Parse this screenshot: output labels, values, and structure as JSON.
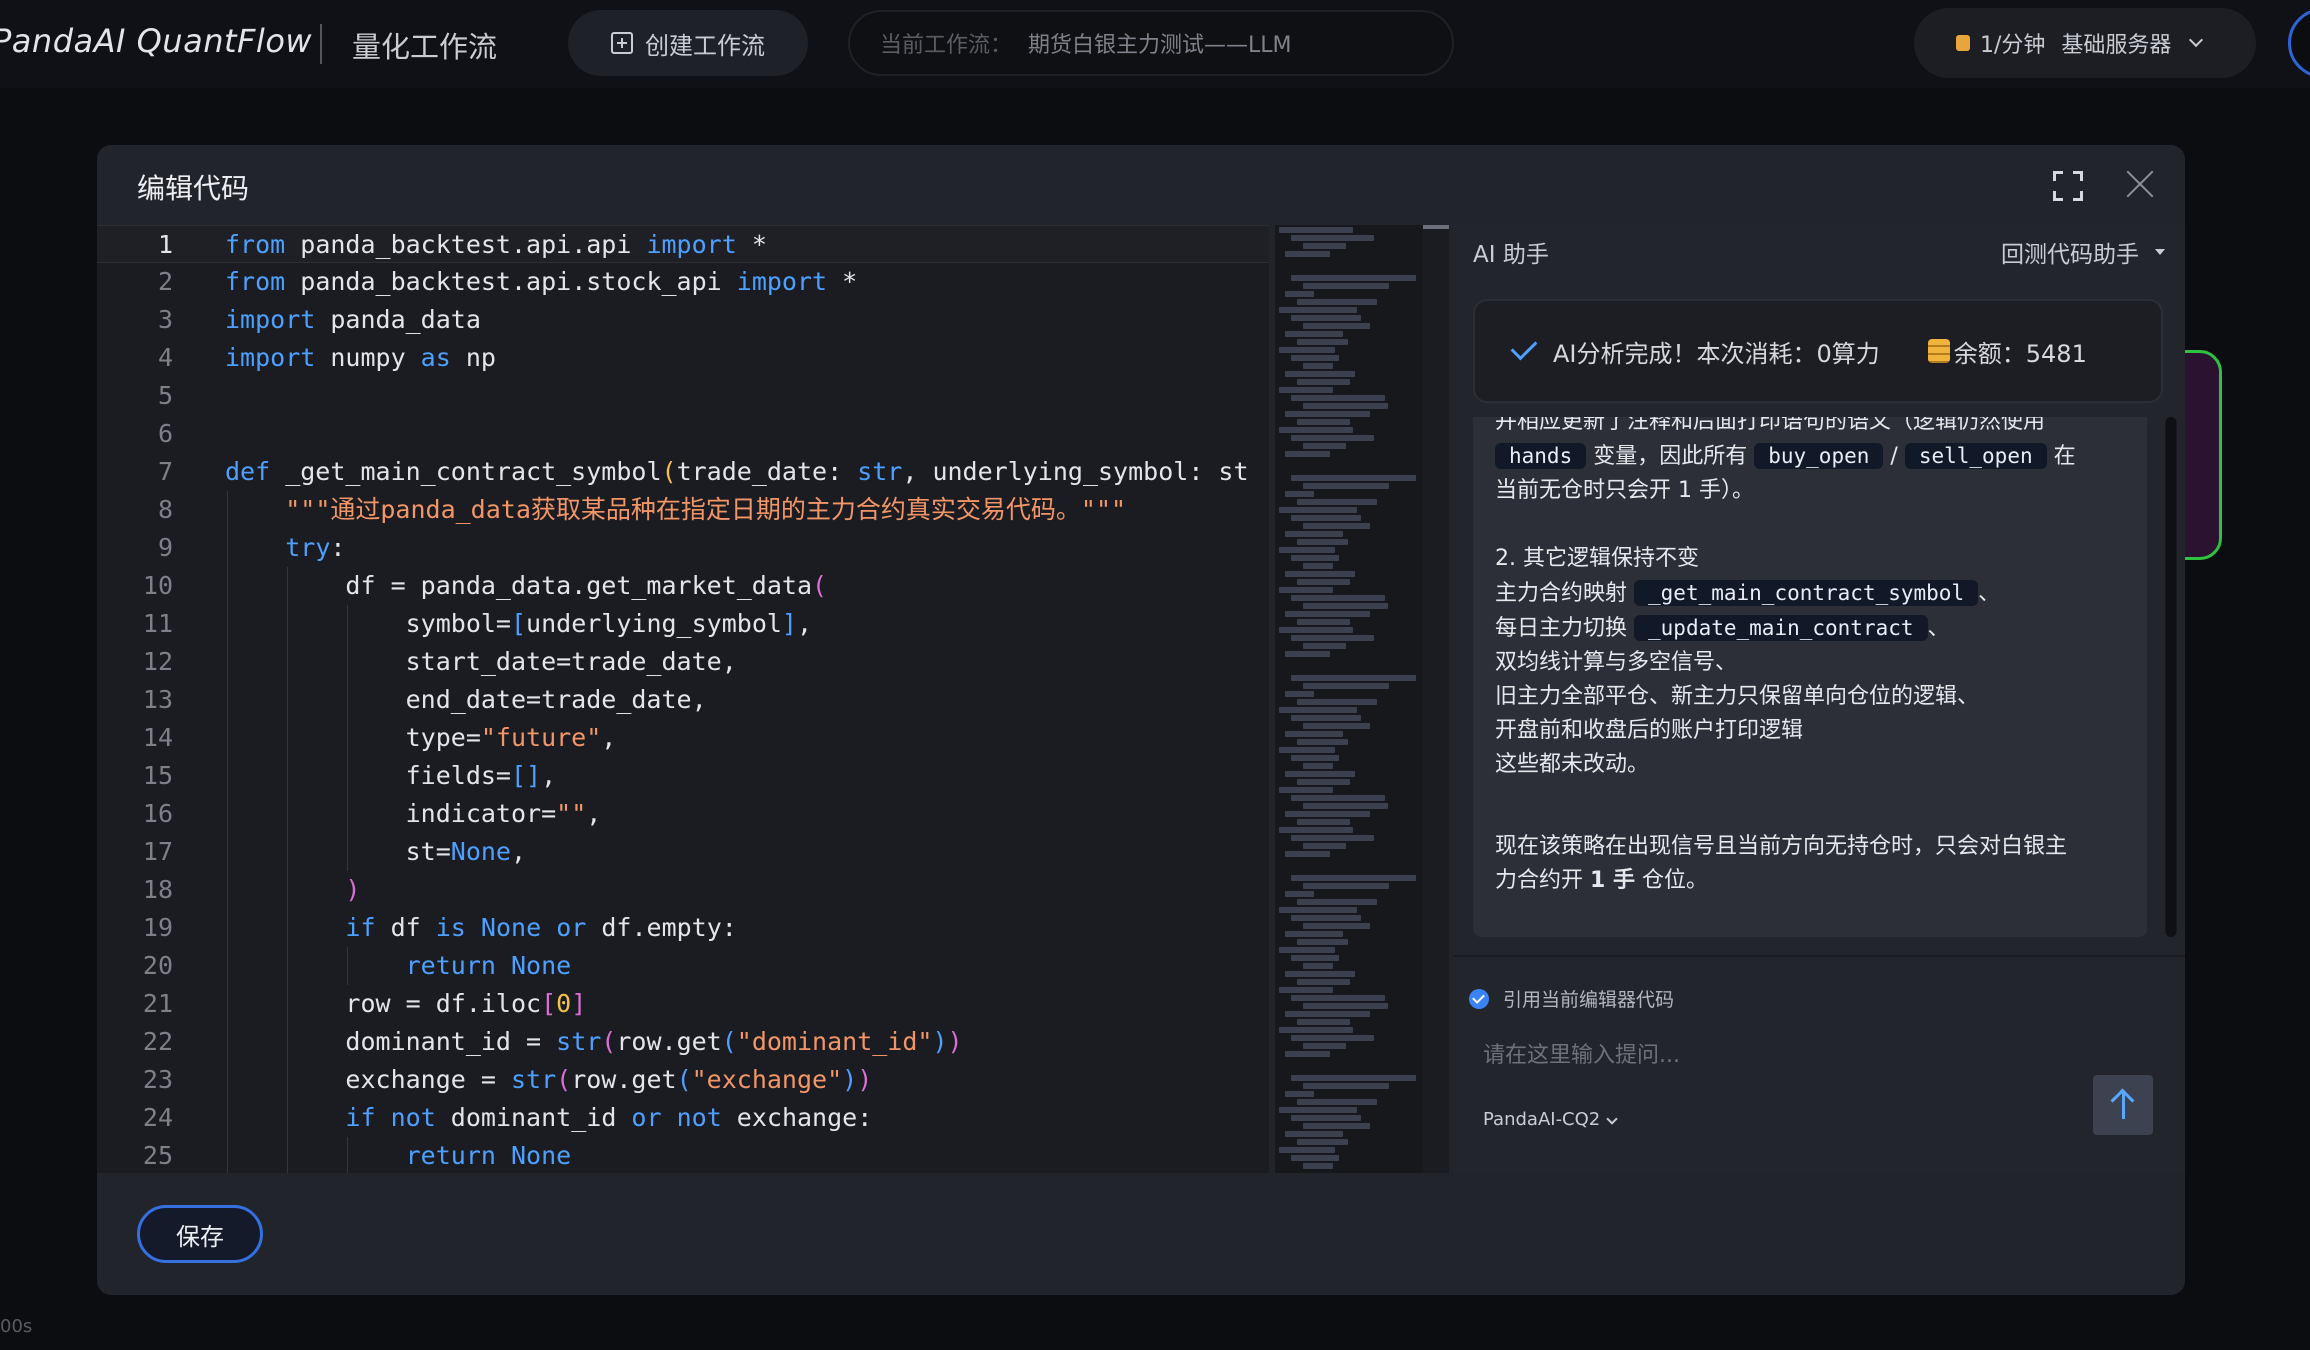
{
  "topbar": {
    "brand": "PandaAI QuantFlow",
    "subtitle": "量化工作流",
    "create_button": "创建工作流",
    "workflow_label": "当前工作流：",
    "workflow_name": "期货白银主力测试——LLM",
    "rate": "1/分钟",
    "server": "基础服务器"
  },
  "background": {
    "time_label": "00s"
  },
  "modal": {
    "title": "编辑代码",
    "save_label": "保存"
  },
  "editor": {
    "lines": [
      {
        "n": "1",
        "code": "from panda_backtest.api.api import *"
      },
      {
        "n": "2",
        "code": "from panda_backtest.api.stock_api import *"
      },
      {
        "n": "3",
        "code": "import panda_data"
      },
      {
        "n": "4",
        "code": "import numpy as np"
      },
      {
        "n": "5",
        "code": ""
      },
      {
        "n": "6",
        "code": ""
      },
      {
        "n": "7",
        "code": "def _get_main_contract_symbol(trade_date: str, underlying_symbol: st"
      },
      {
        "n": "8",
        "code": "    \"\"\"通过panda_data获取某品种在指定日期的主力合约真实交易代码。\"\"\""
      },
      {
        "n": "9",
        "code": "    try:"
      },
      {
        "n": "10",
        "code": "        df = panda_data.get_market_data("
      },
      {
        "n": "11",
        "code": "            symbol=[underlying_symbol],"
      },
      {
        "n": "12",
        "code": "            start_date=trade_date,"
      },
      {
        "n": "13",
        "code": "            end_date=trade_date,"
      },
      {
        "n": "14",
        "code": "            type=\"future\","
      },
      {
        "n": "15",
        "code": "            fields=[],"
      },
      {
        "n": "16",
        "code": "            indicator=\"\","
      },
      {
        "n": "17",
        "code": "            st=None,"
      },
      {
        "n": "18",
        "code": "        )"
      },
      {
        "n": "19",
        "code": "        if df is None or df.empty:"
      },
      {
        "n": "20",
        "code": "            return None"
      },
      {
        "n": "21",
        "code": "        row = df.iloc[0]"
      },
      {
        "n": "22",
        "code": "        dominant_id = str(row.get(\"dominant_id\"))"
      },
      {
        "n": "23",
        "code": "        exchange = str(row.get(\"exchange\"))"
      },
      {
        "n": "24",
        "code": "        if not dominant_id or not exchange:"
      },
      {
        "n": "25",
        "code": "            return None"
      }
    ]
  },
  "ai": {
    "title": "AI 助手",
    "mode": "回测代码助手",
    "status_done": "AI分析完成！本次消耗：0算力",
    "balance": "余额：5481",
    "msg": {
      "l1": "并相应更新了注释和后面打印语句的语义（逻辑仍然使用",
      "l2_code1": "hands",
      "l2_text1": "变量，因此所有",
      "l2_code2": "buy_open",
      "l2_sep": "/",
      "l2_code3": "sell_open",
      "l2_text2": "在",
      "l3": "当前无仓时只会开 1 手）。",
      "h2": "2. 其它逻辑保持不变",
      "l4_text": "主力合约映射",
      "l4_code": "_get_main_contract_symbol",
      "l4_tail": "、",
      "l5_text": "每日主力切换",
      "l5_code": "_update_main_contract",
      "l5_tail": "、",
      "l6": "双均线计算与多空信号、",
      "l7": "旧主力全部平仓、新主力只保留单向仓位的逻辑、",
      "l8": "开盘前和收盘后的账户打印逻辑",
      "l9": "这些都未改动。",
      "l10": "现在该策略在出现信号且当前方向无持仓时，只会对白银主",
      "l11_a": "力合约开",
      "l11_b": "1 手",
      "l11_c": "仓位。"
    },
    "cite_label": "引用当前编辑器代码",
    "input_placeholder": "请在这里输入提问...",
    "model": "PandaAI-CQ2"
  }
}
